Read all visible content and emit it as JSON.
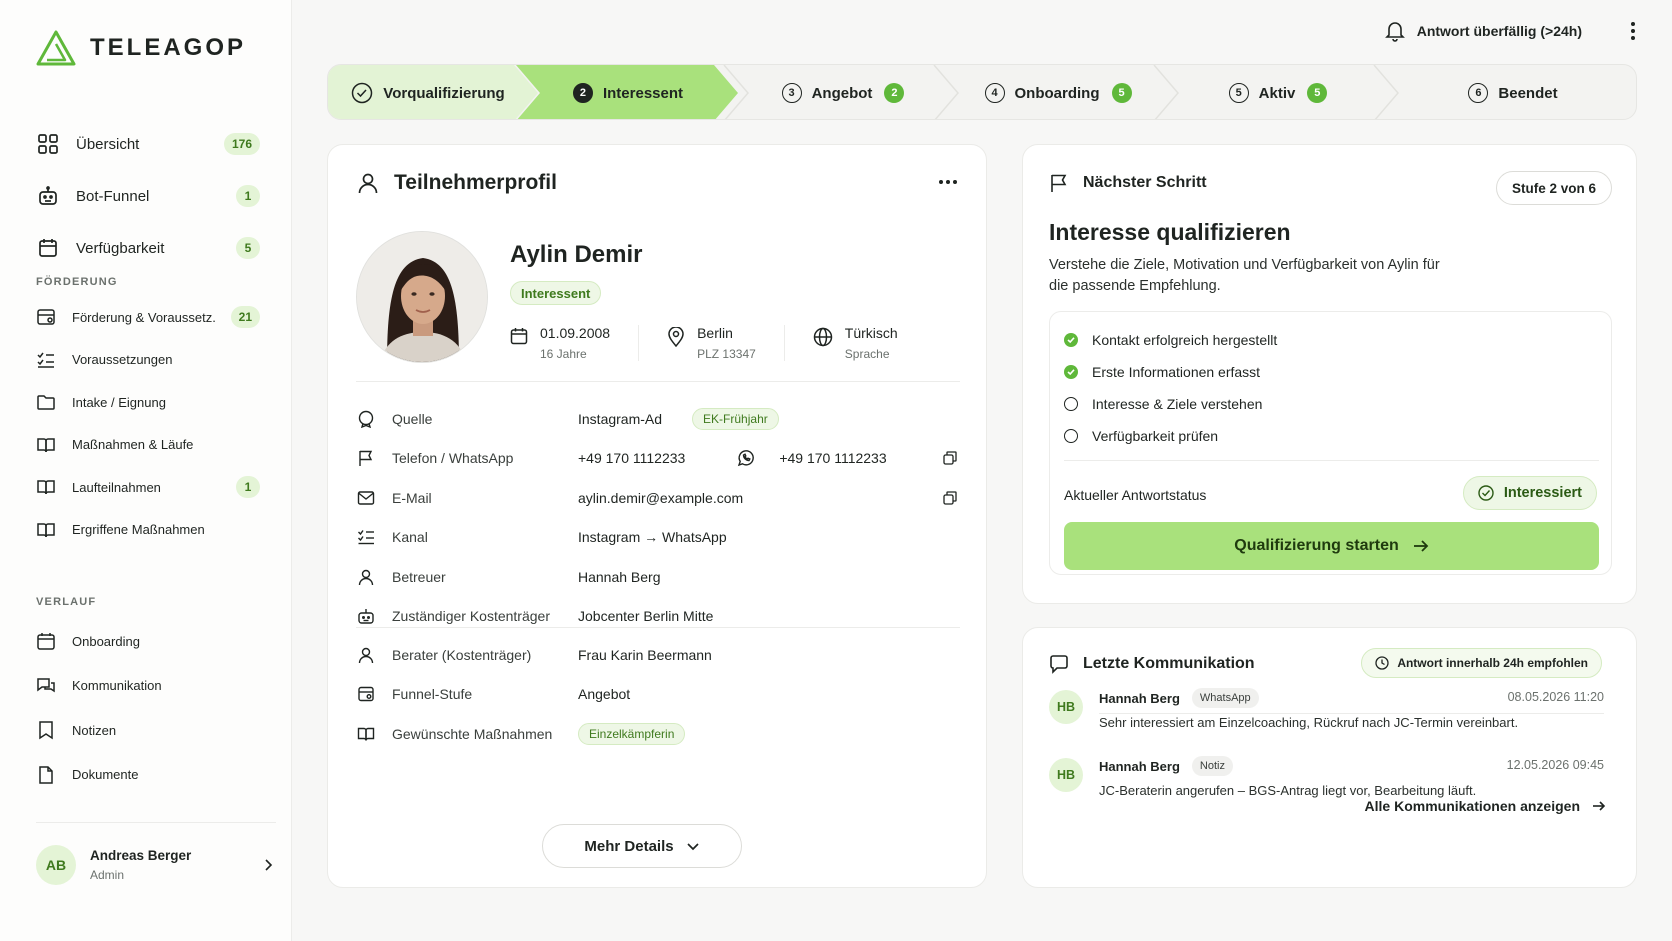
{
  "brand": {
    "name": "TELEAGOP",
    "accent": "#5fb83a",
    "accent_light": "#a9e17c"
  },
  "sidebar": {
    "main": [
      {
        "label": "Übersicht",
        "badge": "176",
        "icon": "grid-icon"
      },
      {
        "label": "Bot-Funnel",
        "badge": "1",
        "icon": "robot-icon"
      },
      {
        "label": "Verfügbarkeit",
        "badge": "5",
        "icon": "calendar-icon"
      }
    ],
    "section_foerderung": "FÖRDERUNG",
    "foerderung": [
      {
        "label": "Förderung & Voraussetz.",
        "badge": "21",
        "icon": "card-icon"
      },
      {
        "label": "Voraussetzungen",
        "badge": "",
        "icon": "checklist-icon"
      },
      {
        "label": "Intake / Eignung",
        "badge": "",
        "icon": "folder-icon"
      },
      {
        "label": "Maßnahmen & Läufe",
        "badge": "",
        "icon": "book-icon"
      },
      {
        "label": "Laufteilnahmen",
        "badge": "1",
        "icon": "book-icon"
      },
      {
        "label": "Ergriffene Maßnahmen",
        "badge": "",
        "icon": "book-icon"
      }
    ],
    "section_verlauf": "VERLAUF",
    "verlauf": [
      {
        "label": "Onboarding",
        "icon": "calendar-icon"
      },
      {
        "label": "Kommunikation",
        "icon": "chat-icon"
      },
      {
        "label": "Notizen",
        "icon": "bookmark-icon"
      },
      {
        "label": "Dokumente",
        "icon": "file-icon"
      }
    ],
    "user": {
      "initials": "AB",
      "name": "Andreas Berger",
      "role": "Admin"
    }
  },
  "topbar": {
    "alert": "Antwort überfällig (>24h)"
  },
  "stepper": [
    {
      "num": "",
      "label": "Vorqualifizierung",
      "count": "",
      "state": "done"
    },
    {
      "num": "2",
      "label": "Interessent",
      "count": "",
      "state": "active"
    },
    {
      "num": "3",
      "label": "Angebot",
      "count": "2",
      "state": "todo"
    },
    {
      "num": "4",
      "label": "Onboarding",
      "count": "5",
      "state": "todo"
    },
    {
      "num": "5",
      "label": "Aktiv",
      "count": "5",
      "state": "todo"
    },
    {
      "num": "6",
      "label": "Beendet",
      "count": "",
      "state": "todo"
    }
  ],
  "profile": {
    "title": "Teilnehmerprofil",
    "name": "Aylin Demir",
    "status": "Interessent",
    "birth": {
      "value": "01.09.2008",
      "sub": "16 Jahre"
    },
    "city": {
      "value": "Berlin",
      "sub": "PLZ 13347"
    },
    "language": {
      "value": "Türkisch",
      "sub": "Sprache"
    },
    "rows": [
      {
        "key": "Quelle",
        "value": "Instagram-Ad",
        "tag": "EK-Frühjahr",
        "icon": "badge-icon"
      },
      {
        "key": "Telefon / WhatsApp",
        "value": "+49 170 1112233",
        "wa": "+49 170 1112233",
        "icon": "flag-icon"
      },
      {
        "key": "E-Mail",
        "value": "aylin.demir@example.com",
        "icon": "mail-icon"
      },
      {
        "key": "Kanal",
        "value": "Instagram → WhatsApp",
        "icon": "checklist-icon"
      },
      {
        "key": "Betreuer",
        "value": "Hannah Berg",
        "icon": "person-icon"
      },
      {
        "key": "Zuständiger Kostenträger",
        "value": "Jobcenter Berlin Mitte",
        "icon": "robot-icon"
      }
    ],
    "rows2": [
      {
        "key": "Berater (Kostenträger)",
        "value": "Frau Karin Beermann",
        "icon": "person-icon"
      },
      {
        "key": "Funnel-Stufe",
        "value": "Angebot",
        "icon": "card-icon"
      },
      {
        "key": "Gewünschte Maßnahmen",
        "tag": "Einzelkämpferin",
        "icon": "book-icon"
      }
    ],
    "more": "Mehr Details"
  },
  "next": {
    "header": "Nächster Schritt",
    "stage": "Stufe 2 von 6",
    "title": "Interesse qualifizieren",
    "desc": "Verstehe die Ziele, Motivation und Verfügbarkeit von Aylin für die passende Empfehlung.",
    "checks": [
      {
        "label": "Kontakt erfolgreich hergestellt",
        "done": true
      },
      {
        "label": "Erste Informationen erfasst",
        "done": true
      },
      {
        "label": "Interesse & Ziele verstehen",
        "done": false
      },
      {
        "label": "Verfügbarkeit prüfen",
        "done": false
      }
    ],
    "status_label": "Aktueller Antwortstatus",
    "status_value": "Interessiert",
    "cta": "Qualifizierung starten"
  },
  "comm": {
    "header": "Letzte Kommunikation",
    "recommendation": "Antwort innerhalb 24h empfohlen",
    "messages": [
      {
        "initials": "HB",
        "who": "Hannah Berg",
        "channel": "WhatsApp",
        "time": "08.05.2026 11:20",
        "text": "Sehr interessiert am Einzelcoaching, Rückruf nach JC-Termin vereinbart."
      },
      {
        "initials": "HB",
        "who": "Hannah Berg",
        "channel": "Notiz",
        "time": "12.05.2026 09:45",
        "text": "JC-Beraterin angerufen – BGS-Antrag liegt vor, Bearbeitung läuft."
      }
    ],
    "all": "Alle Kommunikationen anzeigen"
  }
}
